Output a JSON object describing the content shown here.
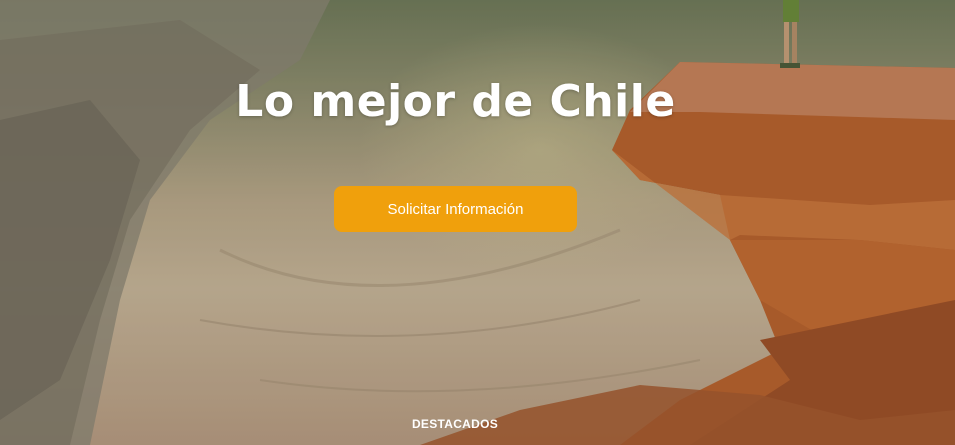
{
  "hero": {
    "title": "Lo mejor de Chile",
    "cta_label": "Solicitar Información",
    "section_label": "DESTACADOS"
  },
  "colors": {
    "cta_background": "#f0a00c",
    "title_text": "#ffffff"
  }
}
